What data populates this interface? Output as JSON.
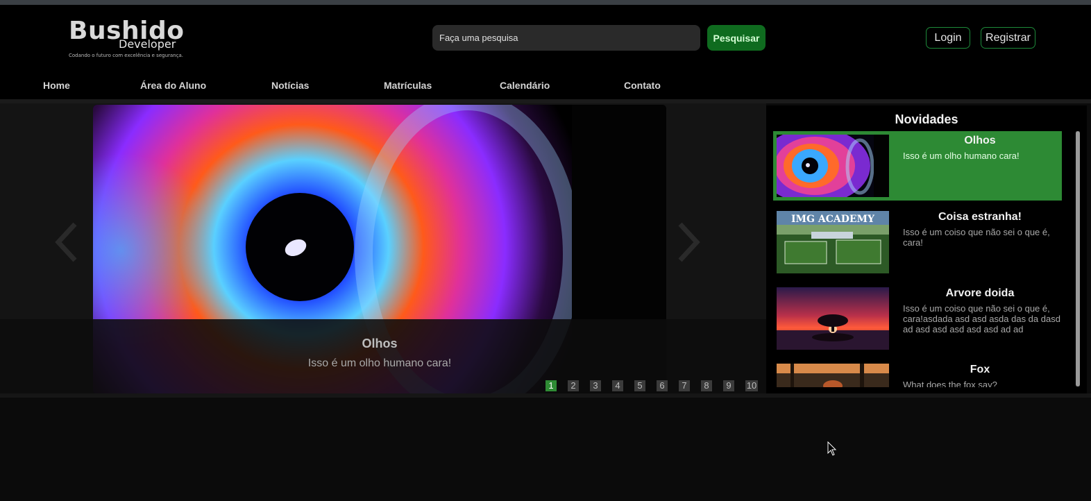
{
  "logo": {
    "title": "Bushido",
    "subtitle": "Developer",
    "tagline": "Codando o futuro com excelência e segurança."
  },
  "search": {
    "placeholder": "Faça uma pesquisa",
    "button_label": "Pesquisar"
  },
  "auth": {
    "login_label": "Login",
    "register_label": "Registrar"
  },
  "nav": {
    "items": [
      "Home",
      "Área do Aluno",
      "Notícias",
      "Matrículas",
      "Calendário",
      "Contato"
    ]
  },
  "carousel": {
    "caption_title": "Olhos",
    "caption_text": "Isso é um olho humano cara!",
    "pages": [
      "1",
      "2",
      "3",
      "4",
      "5",
      "6",
      "7",
      "8",
      "9",
      "10"
    ],
    "active_page": 1
  },
  "sidebar": {
    "title": "Novidades",
    "items": [
      {
        "title": "Olhos",
        "description": "Isso é um olho humano cara!",
        "active": true
      },
      {
        "title": "Coisa estranha!",
        "description": "Isso é um coiso que não sei o que é, cara!",
        "active": false,
        "thumb_text": "IMG ACADEMY"
      },
      {
        "title": "Arvore doida",
        "description": "Isso é um coiso que não sei o que é, cara!asdada asd asd asda das da dasd ad asd asd asd asd asd ad ad",
        "active": false
      },
      {
        "title": "Fox",
        "description": "What does the fox say?",
        "active": false
      }
    ]
  },
  "colors": {
    "accent_green": "#2d8a34",
    "button_green": "#0f6b1f",
    "background": "#0b0b0b"
  }
}
